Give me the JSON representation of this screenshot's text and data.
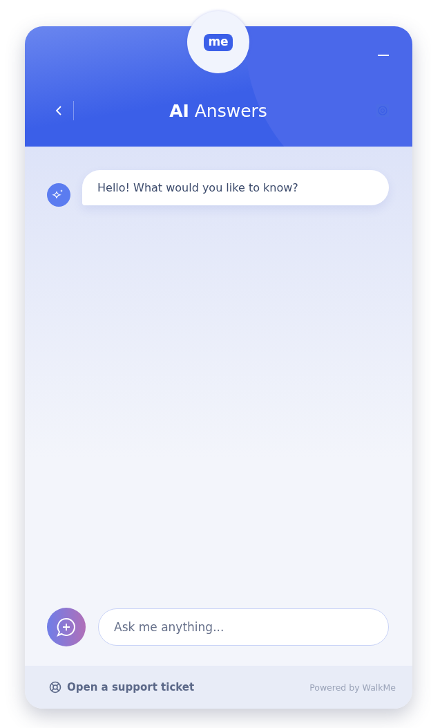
{
  "header": {
    "logo_text": "me",
    "title": "**AI** Answers"
  },
  "messages": [
    {
      "text": "Hello! What would you like to know?"
    }
  ],
  "composer": {
    "placeholder": "Ask me anything..."
  },
  "footer": {
    "support_link": "Open a support ticket",
    "powered_by": "Powered by WalkMe"
  }
}
